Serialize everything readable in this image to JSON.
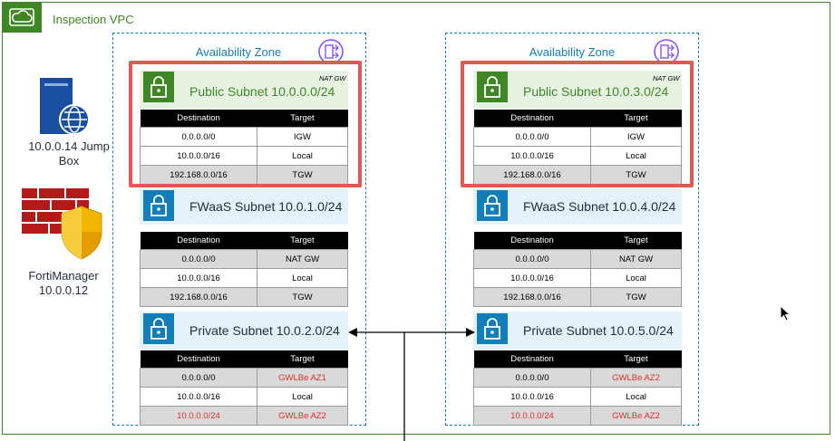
{
  "vpc": {
    "title": "Inspection VPC"
  },
  "left": {
    "jump_box": "10.0.0.14 Jump Box",
    "fortimanager_line1": "FortiManager",
    "fortimanager_line2": "10.0.0.12"
  },
  "columns": {
    "c1": "Destination",
    "c2": "Target"
  },
  "az1": {
    "label": "Availability Zone",
    "public": {
      "label": "Public Subnet 10.0.0.0/24",
      "tag": "NAT GW",
      "rows": [
        {
          "dest": "0.0.0.0/0",
          "target": "IGW"
        },
        {
          "dest": "10.0.0.0/16",
          "target": "Local"
        },
        {
          "dest": "192.168.0.0/16",
          "target": "TGW"
        }
      ]
    },
    "fwaas": {
      "label": "FWaaS Subnet 10.0.1.0/24",
      "rows": [
        {
          "dest": "0.0.0.0/0",
          "target": "NAT GW"
        },
        {
          "dest": "10.0.0.0/16",
          "target": "Local"
        },
        {
          "dest": "192.168.0.0/16",
          "target": "TGW"
        }
      ]
    },
    "private": {
      "label": "Private Subnet 10.0.2.0/24",
      "rows": [
        {
          "dest": "0.0.0.0/0",
          "target": "GWLBe AZ1"
        },
        {
          "dest": "10.0.0.0/16",
          "target": "Local"
        },
        {
          "dest": "10.0.0.0/24",
          "target": "GWLBe AZ2"
        }
      ]
    }
  },
  "az2": {
    "label": "Availability Zone",
    "public": {
      "label": "Public Subnet 10.0.3.0/24",
      "tag": "NAT GW",
      "rows": [
        {
          "dest": "0.0.0.0/0",
          "target": "IGW"
        },
        {
          "dest": "10.0.0.0/16",
          "target": "Local"
        },
        {
          "dest": "192.168.0.0/16",
          "target": "TGW"
        }
      ]
    },
    "fwaas": {
      "label": "FWaaS Subnet 10.0.4.0/24",
      "rows": [
        {
          "dest": "0.0.0.0/0",
          "target": "NAT GW"
        },
        {
          "dest": "10.0.0.0/16",
          "target": "Local"
        },
        {
          "dest": "192.168.0.0/16",
          "target": "TGW"
        }
      ]
    },
    "private": {
      "label": "Private Subnet 10.0.5.0/24",
      "rows": [
        {
          "dest": "0.0.0.0/0",
          "target": "GWLBe AZ2"
        },
        {
          "dest": "10.0.0.0/16",
          "target": "Local"
        },
        {
          "dest": "10.0.0.0/24",
          "target": "GWLBe AZ2"
        }
      ]
    }
  },
  "colors": {
    "vpc_green": "#3f8624",
    "az_blue": "#147eba",
    "highlight_red": "#e05a55",
    "route_red": "#e0302a"
  }
}
